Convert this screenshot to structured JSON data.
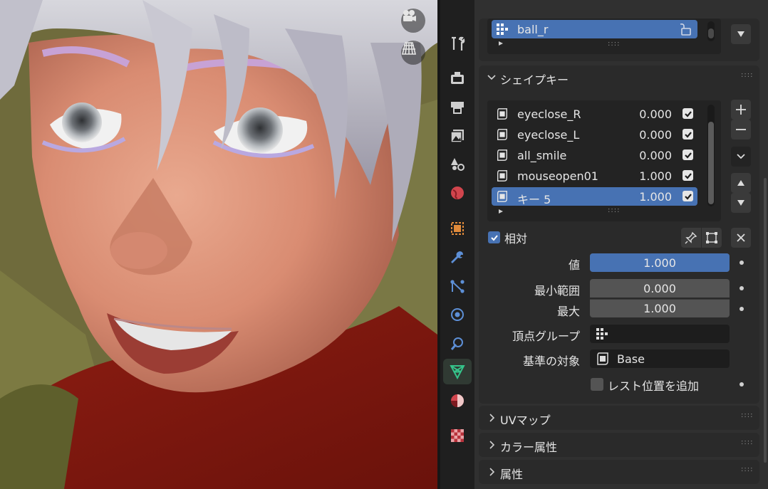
{
  "colors": {
    "accent": "#4772b3",
    "panel_bg": "#303030",
    "tab_active_icon": "#35c38a"
  },
  "vertex_groups": {
    "selected_item": "ball_r"
  },
  "shape_keys": {
    "title": "シェイプキー",
    "items": [
      {
        "name": "eyeclose_R",
        "value": "0.000",
        "checked": true
      },
      {
        "name": "eyeclose_L",
        "value": "0.000",
        "checked": true
      },
      {
        "name": "all_smile",
        "value": "0.000",
        "checked": true
      },
      {
        "name": "mouseopen01",
        "value": "1.000",
        "checked": true
      },
      {
        "name": "キー 5",
        "value": "1.000",
        "checked": true,
        "selected": true
      }
    ],
    "relative_label": "相対",
    "relative_checked": true,
    "value_label": "値",
    "value": "1.000",
    "value_fill": 1.0,
    "min_label": "最小範囲",
    "min_value": "0.000",
    "max_label": "最大",
    "max_value": "1.000",
    "vertex_group_label": "頂点グループ",
    "vertex_group_value": "",
    "relative_to_label": "基準の対象",
    "relative_to_value": "Base",
    "rest_position_label": "レスト位置を追加",
    "rest_position_checked": false
  },
  "sections": {
    "uv_maps": "UVマップ",
    "color_attributes": "カラー属性",
    "attributes": "属性"
  },
  "tabs": [
    {
      "name": "tool-tab",
      "icon": "wrench-screwdriver-icon"
    },
    {
      "name": "render-tab",
      "icon": "camera-back-icon"
    },
    {
      "name": "output-tab",
      "icon": "printer-icon"
    },
    {
      "name": "view-layer-tab",
      "icon": "image-stack-icon"
    },
    {
      "name": "scene-tab",
      "icon": "scene-icon"
    },
    {
      "name": "world-tab",
      "icon": "globe-icon"
    },
    {
      "name": "object-tab",
      "icon": "object-square-icon"
    },
    {
      "name": "modifier-tab",
      "icon": "wrench-icon"
    },
    {
      "name": "particles-tab",
      "icon": "particles-icon"
    },
    {
      "name": "physics-tab",
      "icon": "physics-icon"
    },
    {
      "name": "constraints-tab",
      "icon": "constraint-icon"
    },
    {
      "name": "data-tab",
      "icon": "mesh-data-icon",
      "active": true
    },
    {
      "name": "material-tab",
      "icon": "material-sphere-icon"
    },
    {
      "name": "texture-tab",
      "icon": "checker-texture-icon"
    }
  ]
}
